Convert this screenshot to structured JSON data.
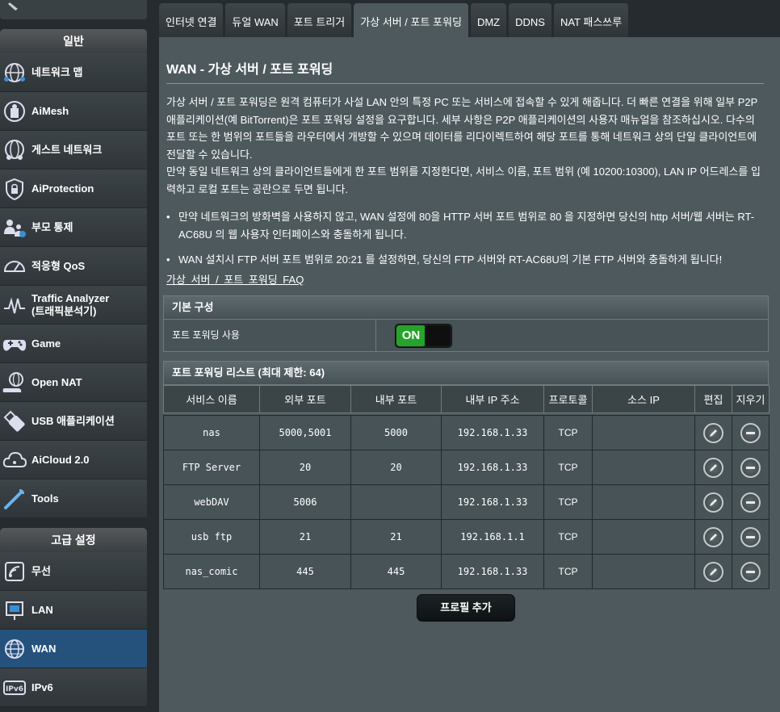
{
  "sidebar": {
    "general_header": "일반",
    "advanced_header": "고급 설정",
    "general_items": [
      {
        "label": "네트워크 맵",
        "icon": "network-map-icon"
      },
      {
        "label": "AiMesh",
        "icon": "aimesh-icon"
      },
      {
        "label": "게스트 네트워크",
        "icon": "guest-network-icon"
      },
      {
        "label": "AiProtection",
        "icon": "aiprotection-lock-icon"
      },
      {
        "label": "부모 통제",
        "icon": "parental-control-icon"
      },
      {
        "label": "적응형 QoS",
        "icon": "qos-gauge-icon"
      },
      {
        "label": "Traffic Analyzer",
        "label2": "(트래픽분석기)",
        "icon": "traffic-analyzer-icon"
      },
      {
        "label": "Game",
        "icon": "gamepad-icon"
      },
      {
        "label": "Open NAT",
        "icon": "open-nat-icon"
      },
      {
        "label": "USB 애플리케이션",
        "icon": "usb-icon"
      },
      {
        "label": "AiCloud 2.0",
        "icon": "cloud-icon"
      },
      {
        "label": "Tools",
        "icon": "wrench-icon"
      }
    ],
    "advanced_items": [
      {
        "label": "무선",
        "icon": "wireless-icon"
      },
      {
        "label": "LAN",
        "icon": "lan-icon"
      },
      {
        "label": "WAN",
        "icon": "wan-globe-icon",
        "active": true
      },
      {
        "label": "IPv6",
        "icon": "ipv6-icon"
      }
    ]
  },
  "tabs": [
    "인터넷 연결",
    "듀얼 WAN",
    "포트 트리거",
    "가상 서버 / 포트 포워딩",
    "DMZ",
    "DDNS",
    "NAT 패스쓰루"
  ],
  "active_tab": 3,
  "page": {
    "title": "WAN - 가상 서버 / 포트 포워딩",
    "desc1": "가상 서버 / 포트 포워딩은 원격 컴퓨터가 사설 LAN 안의 특정 PC 또는 서비스에 접속할 수 있게 해줍니다. 더 빠른 연결을 위해 일부 P2P 애플리케이션(예 BitTorrent)은 포트 포워딩 설정을 요구합니다. 세부 사항은 P2P 애플리케이션의 사용자 매뉴얼을 참조하십시오. 다수의 포트 또는 한 범위의 포트들을 라우터에서 개방할 수 있으며 데이터를 리다이렉트하여 해당 포트를 통해 네트워크 상의 단일 클라이언트에 전달할 수 있습니다.",
    "desc2": "만약 동일 네트워크 상의 클라이언트들에게 한 포트 범위를 지정한다면, 서비스 이름, 포트 범위 (예 10200:10300), LAN IP 어드레스를 입력하고 로컬 포트는 공란으로 두면 됩니다.",
    "bullet1": "만약 네트워크의 방화벽을 사용하지 않고, WAN 설정에 80을 HTTP 서버 포트 범위로 80 을 지정하면 당신의 http 서버/웹 서버는 RT-AC68U 의 웹 사용자 인터페이스와 충돌하게 됩니다.",
    "bullet2": "WAN 설치시 FTP 서버 포트 범위로 20:21 를 설정하면, 당신의 FTP 서버와 RT-AC68U의 기본 FTP 서버와 충돌하게 됩니다!",
    "faq": "가상 서버 / 포트 포워딩 FAQ"
  },
  "basic_config": {
    "header": "기본 구성",
    "enable_label": "포트 포워딩 사용",
    "toggle_text": "ON"
  },
  "forward_list": {
    "header": "포트 포워딩 리스트 (최대 제한: 64)",
    "columns": [
      "서비스 이름",
      "외부 포트",
      "내부 포트",
      "내부 IP 주소",
      "프로토콜",
      "소스 IP",
      "편집",
      "지우기"
    ],
    "rows": [
      {
        "name": "nas",
        "ext": "5000,5001",
        "int": "5000",
        "ip": "192.168.1.33",
        "proto": "TCP",
        "src": ""
      },
      {
        "name": "FTP Server",
        "ext": "20",
        "int": "20",
        "ip": "192.168.1.33",
        "proto": "TCP",
        "src": ""
      },
      {
        "name": "webDAV",
        "ext": "5006",
        "int": "",
        "ip": "192.168.1.33",
        "proto": "TCP",
        "src": ""
      },
      {
        "name": "usb ftp",
        "ext": "21",
        "int": "21",
        "ip": "192.168.1.1",
        "proto": "TCP",
        "src": ""
      },
      {
        "name": "nas_comic",
        "ext": "445",
        "int": "445",
        "ip": "192.168.1.33",
        "proto": "TCP",
        "src": ""
      }
    ],
    "add_button": "프로필 추가"
  }
}
